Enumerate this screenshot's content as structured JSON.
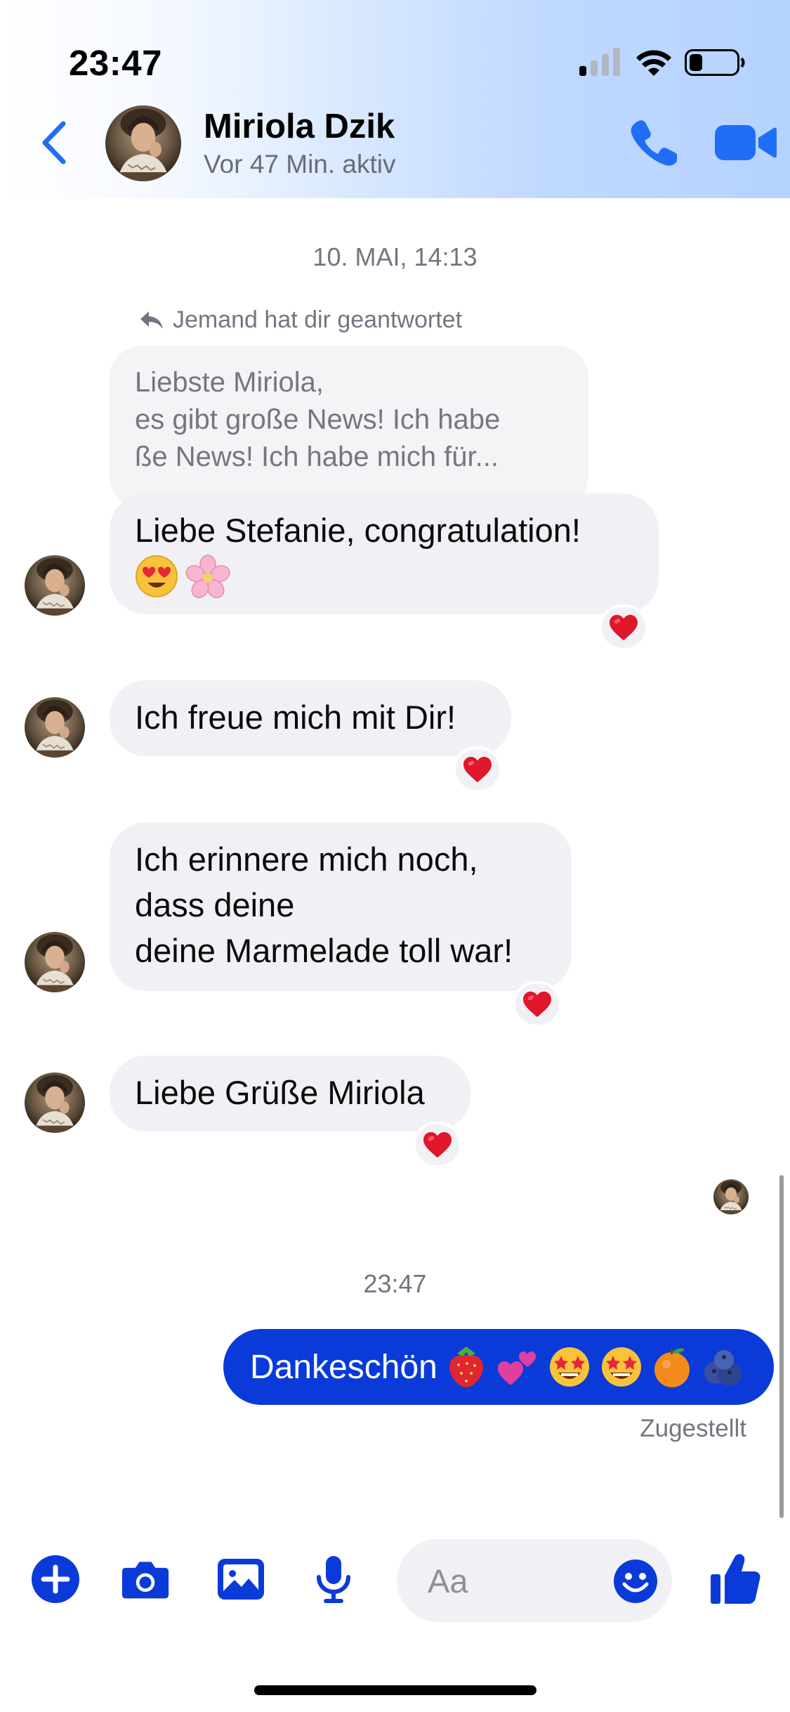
{
  "status_bar": {
    "time": "23:47"
  },
  "header": {
    "name": "Miriola Dzik",
    "status": "Vor 47 Min. aktiv"
  },
  "chat": {
    "date_separator": "10. MAI, 14:13",
    "reply_hint": "Jemand hat dir geantwortet",
    "quoted_lines": [
      "Liebste Miriola,",
      "es gibt große News! Ich habe",
      "ße News! Ich habe mich für..."
    ],
    "messages": [
      {
        "text": "Liebe Stefanie, congratulation!",
        "reaction": "heart"
      },
      {
        "text": "Ich freue mich mit Dir!",
        "reaction": "heart"
      },
      {
        "lines": [
          "Ich erinnere mich noch,",
          "dass deine",
          "deine Marmelade toll war!"
        ],
        "reaction": "heart"
      },
      {
        "text": "Liebe Grüße Miriola",
        "reaction": "heart"
      }
    ],
    "time_separator": "23:47",
    "outgoing": {
      "text": "Dankeschön"
    },
    "delivered": "Zugestellt"
  },
  "composer": {
    "placeholder": "Aa"
  },
  "colors": {
    "accent": "#0a3bd9",
    "icon_blue": "#1f6ef5",
    "heart": "#e0162b"
  },
  "icons": [
    "back-chevron-icon",
    "phone-icon",
    "video-icon",
    "plus-icon",
    "camera-icon",
    "gallery-icon",
    "microphone-icon",
    "emoji-icon",
    "thumbs-up-icon",
    "heart-icon"
  ]
}
